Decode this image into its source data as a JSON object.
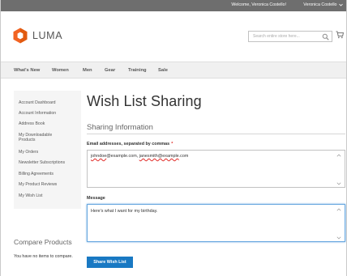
{
  "header_panel": {
    "welcome": "Welcome, Veronica Costello!",
    "account_name": "Veronica Costello"
  },
  "brand": {
    "name": "LUMA",
    "colors": {
      "orange": "#f26322",
      "dark_orange": "#d35400",
      "accent_blue": "#1979c3"
    }
  },
  "search": {
    "placeholder": "Search entire store here..."
  },
  "icons": {
    "search": "search-icon",
    "cart": "cart-icon",
    "logo": "luma-logo-icon"
  },
  "nav": {
    "items": [
      "What's New",
      "Women",
      "Men",
      "Gear",
      "Training",
      "Sale"
    ]
  },
  "sidebar": {
    "items": [
      "Account Dashboard",
      "Account Information",
      "Address Book",
      "My Downloadable Products",
      "My Orders",
      "Newsletter Subscriptions",
      "Billing Agreements",
      "My Product Reviews",
      "My Wish List"
    ],
    "compare_title": "Compare Products",
    "compare_note": "You have no items to compare."
  },
  "main": {
    "title": "Wish List Sharing",
    "section_title": "Sharing Information",
    "emails_label": "Email addresses, separated by commas",
    "required_mark": "*",
    "emails_value": {
      "part1": "johndoe",
      "part2": "@example.com, ",
      "part3": "janesmith@example",
      "part4": ".com"
    },
    "message_label": "Message",
    "message_value": "Here's what I want for my birthday.",
    "share_button": "Share Wish List"
  }
}
